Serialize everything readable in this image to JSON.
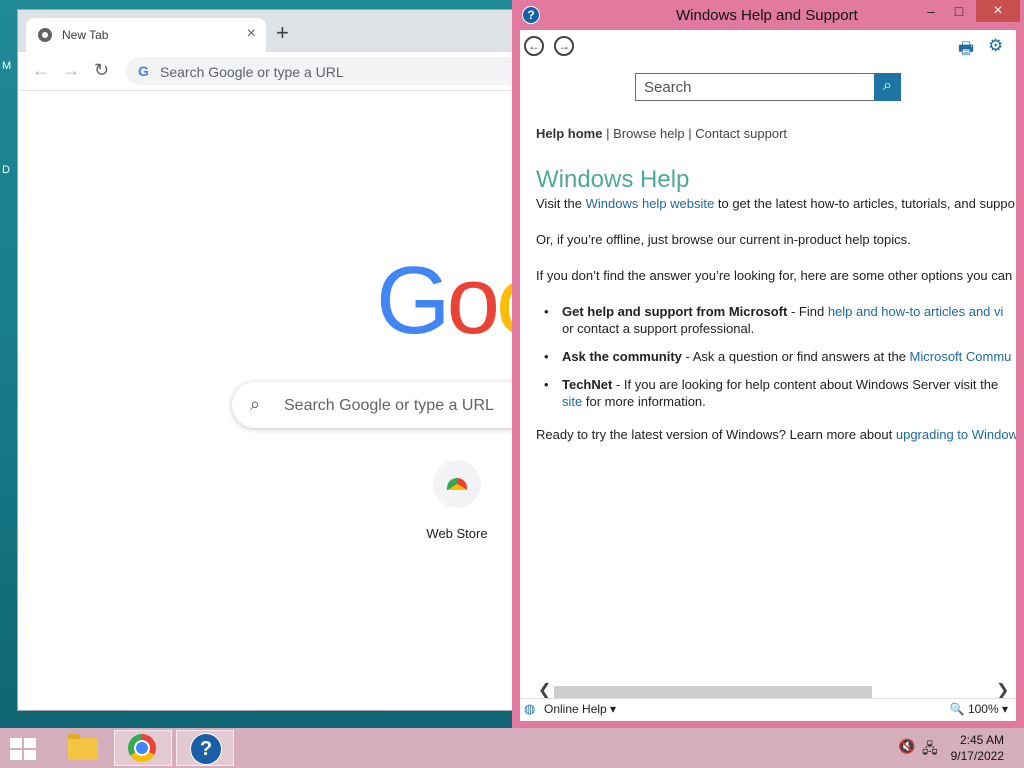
{
  "desktop": {
    "edge_labels": [
      "M",
      "D"
    ]
  },
  "chrome": {
    "tab_title": "New Tab",
    "tab_close": "×",
    "new_tab": "+",
    "nav": {
      "back": "←",
      "forward": "→",
      "reload": "↻"
    },
    "omnibox_icon": "G",
    "omnibox_placeholder": "Search Google or type a URL",
    "logo_letters": [
      "G",
      "o",
      "o"
    ],
    "logo_colors": [
      "#4285f4",
      "#ea4335",
      "#fbbc05"
    ],
    "ntp_search_icon": "⌕",
    "ntp_search_placeholder": "Search Google or type a URL",
    "shortcut_label": "Web Store"
  },
  "help": {
    "title_icon": "?",
    "title": "Windows Help and Support",
    "window_buttons": {
      "minimize": "–",
      "maximize": "□",
      "close": "×"
    },
    "back_icon": "←",
    "forward_icon": "→",
    "print_icon": "🖶",
    "settings_icon": "⚙",
    "search_placeholder": "Search",
    "search_button_icon": "⌕",
    "breadcrumb": {
      "home": "Help home",
      "sep1": " | ",
      "browse": "Browse help",
      "sep2": " | ",
      "contact": "Contact support"
    },
    "heading": "Windows Help",
    "p1": {
      "before": "Visit the ",
      "link": "Windows help website",
      "after": " to get the latest how-to articles, tutorials, and suppo"
    },
    "p2": "Or, if you’re offline, just browse our current in-product help topics.",
    "p3": "If you don’t find the answer you’re looking for, here are some other options you can",
    "bullets": [
      {
        "bold": "Get help and support from Microsoft",
        "text": " - Find ",
        "link": "help and how-to articles and vi",
        "line2": "or contact a support professional."
      },
      {
        "bold": "Ask the community",
        "text": " - Ask a question or find answers at the ",
        "link": "Microsoft Commu"
      },
      {
        "bold": "TechNet",
        "text": " - If you are looking for help content about Windows Server visit the ",
        "line2_link": "site",
        "line2": " for more information."
      }
    ],
    "p4": {
      "before": "Ready to try the latest version of Windows? Learn more about ",
      "link": "upgrading to Window"
    },
    "scroll_left": "❮",
    "scroll_right": "❯",
    "status_icon": "◍",
    "status_online": "Online Help ▾",
    "zoom": "🔍 100% ▾"
  },
  "taskbar": {
    "help_icon": "?",
    "volume_icon": "🔇",
    "network_icon": "🖧",
    "time": "2:45 AM",
    "date": "9/17/2022"
  }
}
